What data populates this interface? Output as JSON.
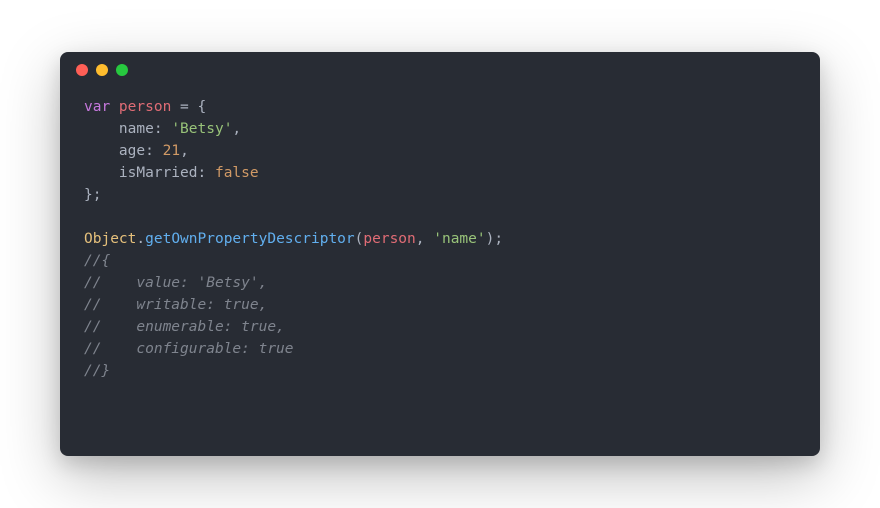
{
  "code": {
    "line1": {
      "kw": "var",
      "var": " person ",
      "punct1": "=",
      "punct2": " {"
    },
    "line2": {
      "indent": "    ",
      "prop": "name",
      "colon": ": ",
      "str": "'Betsy'",
      "comma": ","
    },
    "line3": {
      "indent": "    ",
      "prop": "age",
      "colon": ": ",
      "num": "21",
      "comma": ","
    },
    "line4": {
      "indent": "    ",
      "prop": "isMarried",
      "colon": ": ",
      "bool": "false"
    },
    "line5": {
      "punct": "};"
    },
    "line6": {
      "blank": " "
    },
    "line7": {
      "obj": "Object",
      "dot": ".",
      "method": "getOwnPropertyDescriptor",
      "open": "(",
      "param1": "person",
      "comma": ", ",
      "str": "'name'",
      "close": ");"
    },
    "line8": {
      "comment": "//{"
    },
    "line9": {
      "comment": "//    value: 'Betsy',"
    },
    "line10": {
      "comment": "//    writable: true,"
    },
    "line11": {
      "comment": "//    enumerable: true,"
    },
    "line12": {
      "comment": "//    configurable: true"
    },
    "line13": {
      "comment": "//}"
    }
  }
}
